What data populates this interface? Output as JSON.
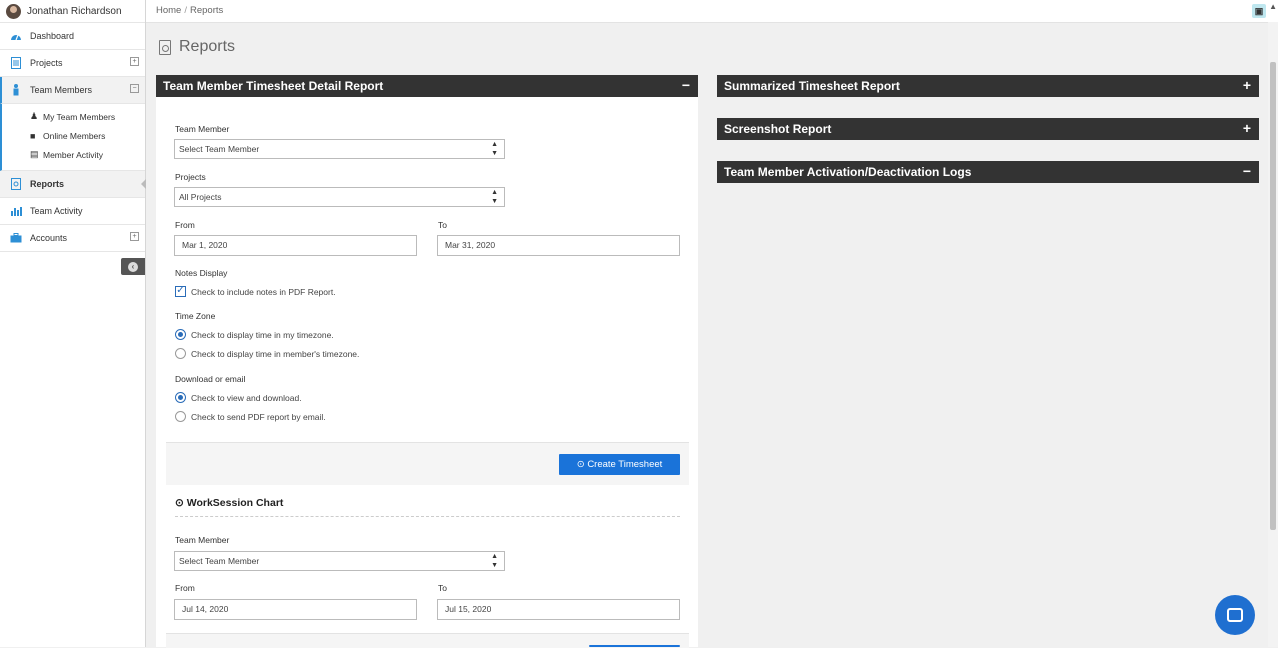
{
  "user": {
    "name": "Jonathan Richardson"
  },
  "sidebar": {
    "items": [
      {
        "label": "Dashboard",
        "icon": "dashboard-icon"
      },
      {
        "label": "Projects",
        "icon": "document-icon",
        "expander": "⊞"
      },
      {
        "label": "Team Members",
        "icon": "person-icon",
        "expander": "⊟"
      },
      {
        "label": "Reports",
        "icon": "pdf-icon"
      },
      {
        "label": "Team Activity",
        "icon": "bar-chart-icon"
      },
      {
        "label": "Accounts",
        "icon": "briefcase-icon",
        "expander": "⊞"
      }
    ],
    "sub_items": [
      {
        "label": "My Team Members",
        "icon": "users-icon"
      },
      {
        "label": "Online Members",
        "icon": "user-square-icon"
      },
      {
        "label": "Member Activity",
        "icon": "id-card-icon"
      }
    ]
  },
  "breadcrumb": {
    "home": "Home",
    "sep": "/",
    "current": "Reports"
  },
  "page": {
    "title": "Reports"
  },
  "panels": {
    "timesheet": {
      "title": "Team Member Timesheet Detail Report",
      "toggle": "−",
      "team_member_label": "Team Member",
      "team_member_value": "Select Team Member",
      "projects_label": "Projects",
      "projects_value": "All Projects",
      "from_label": "From",
      "from_value": "Mar 1, 2020",
      "to_label": "To",
      "to_value": "Mar 31, 2020",
      "notes_label": "Notes Display",
      "notes_option": "Check to include notes in PDF Report.",
      "timezone_label": "Time Zone",
      "tz_option_1": "Check to display time in my timezone.",
      "tz_option_2": "Check to display time in member's timezone.",
      "download_label": "Download or email",
      "dl_option_1": "Check to view and download.",
      "dl_option_2": "Check to send PDF report by email.",
      "create_button": "Create Timesheet"
    },
    "worksession": {
      "title": "WorkSession Chart",
      "team_member_label": "Team Member",
      "team_member_value": "Select Team Member",
      "from_label": "From",
      "from_value": "Jul 14, 2020",
      "to_label": "To",
      "to_value": "Jul 15, 2020"
    },
    "summarized": {
      "title": "Summarized Timesheet Report",
      "toggle": "+"
    },
    "screenshot": {
      "title": "Screenshot Report",
      "toggle": "+"
    },
    "activation": {
      "title": "Team Member Activation/Deactivation Logs",
      "toggle": "−"
    }
  },
  "colors": {
    "primary": "#1a73d9",
    "panel_header": "#333333",
    "accent": "#2d8fd5"
  }
}
